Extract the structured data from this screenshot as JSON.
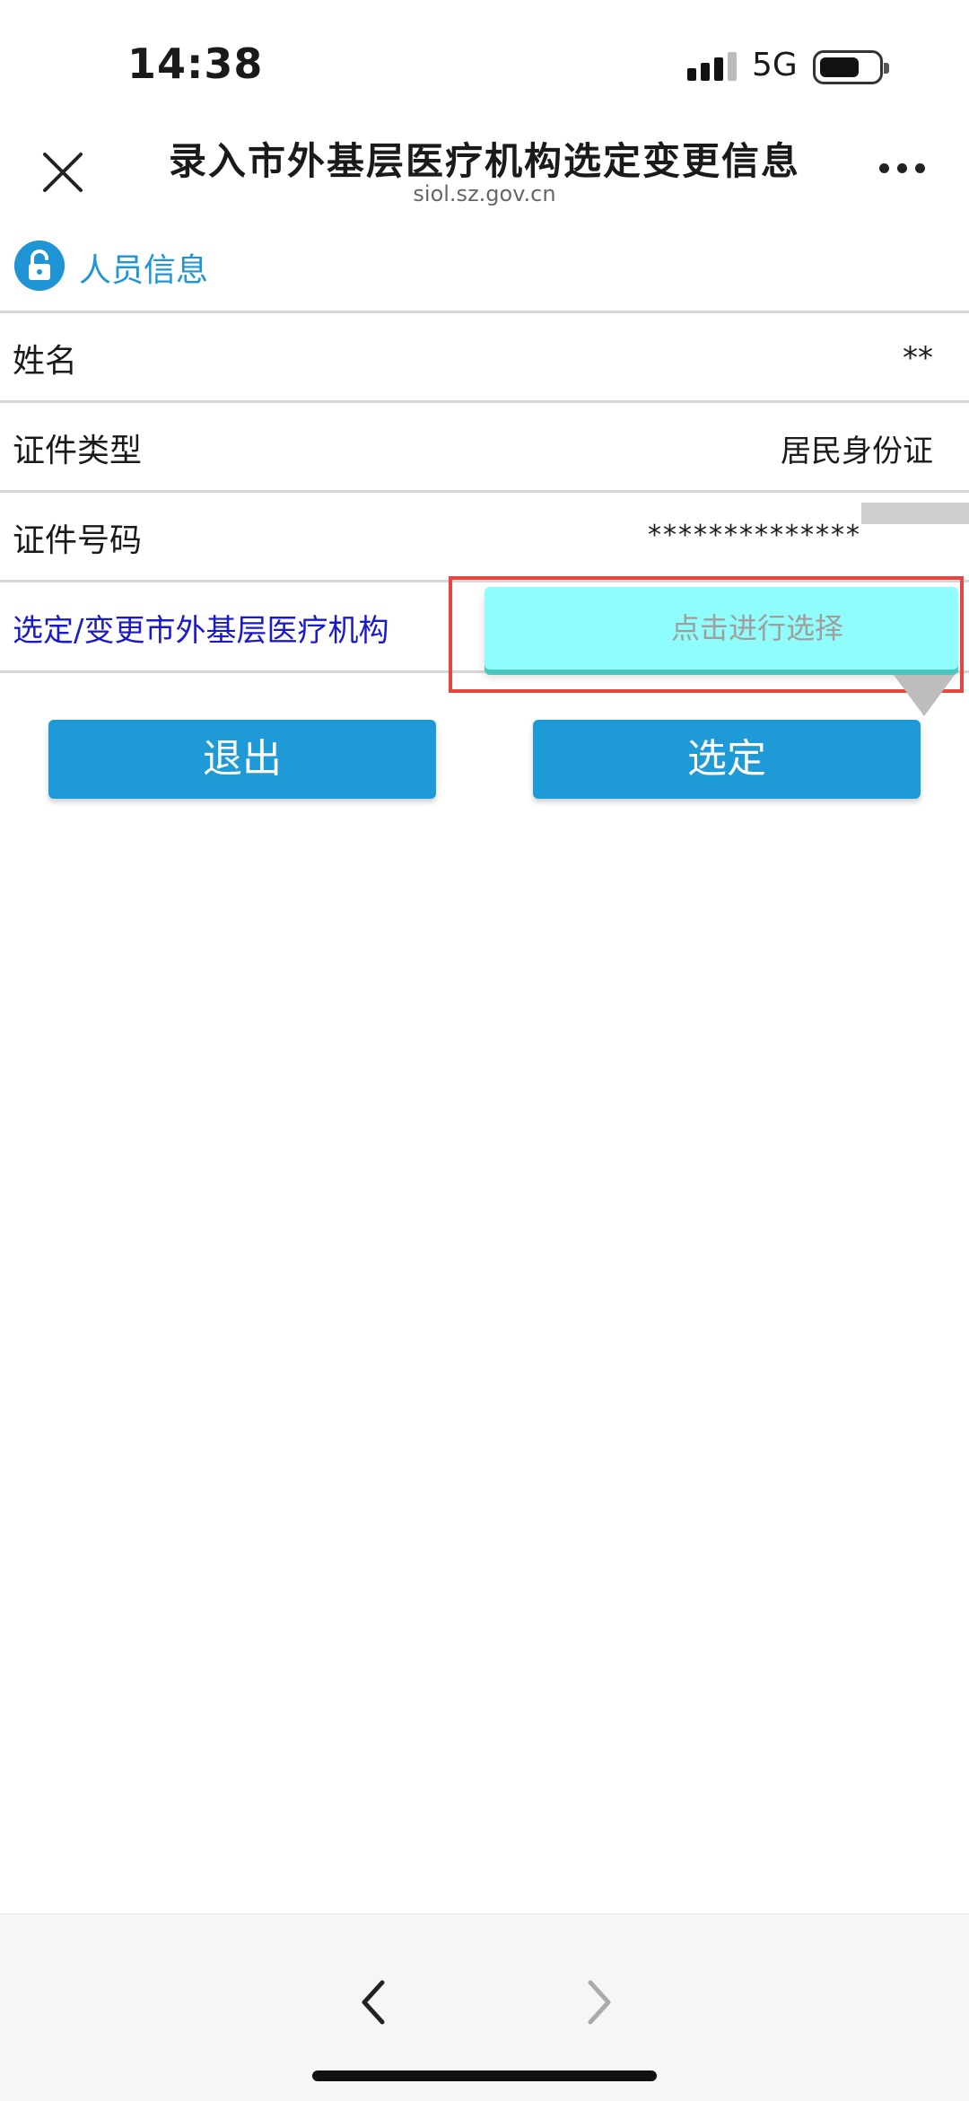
{
  "status_bar": {
    "time": "14:38",
    "network": "5G",
    "battery_level": 0.7
  },
  "title_bar": {
    "title": "录入市外基层医疗机构选定变更信息",
    "subtitle": "siol.sz.gov.cn",
    "close_icon": "close-icon",
    "more_icon": "more-icon"
  },
  "section": {
    "title": "人员信息",
    "icon": "lock-icon"
  },
  "rows": {
    "name": {
      "label": "姓名",
      "value": "**"
    },
    "id_type": {
      "label": "证件类型",
      "value": "居民身份证"
    },
    "id_number": {
      "label": "证件号码",
      "value": "**************"
    },
    "org": {
      "label": "选定/变更市外基层医疗机构",
      "placeholder": "点击进行选择"
    }
  },
  "buttons": {
    "exit": "退出",
    "select": "选定"
  },
  "nav": {
    "back_icon": "chevron-left-icon",
    "forward_icon": "chevron-right-icon"
  },
  "colors": {
    "accent": "#1e9ad6",
    "select_bg": "#8ffdfb",
    "highlight": "#e5463f",
    "org_label": "#1a1ac8"
  }
}
